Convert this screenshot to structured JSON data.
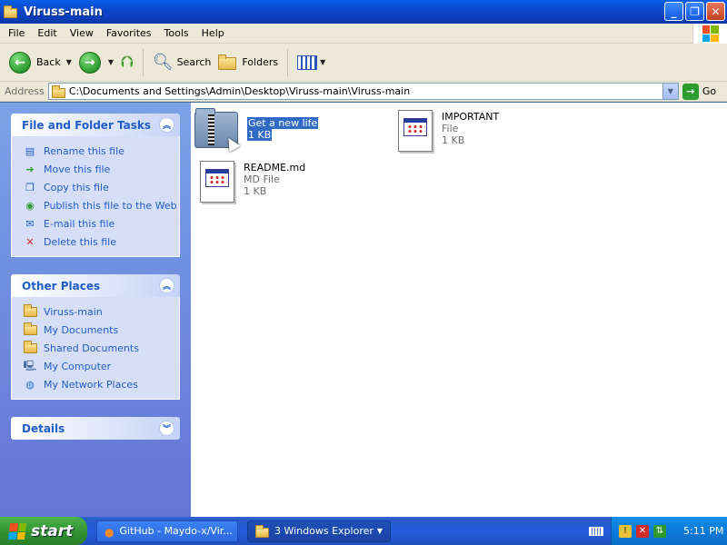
{
  "window": {
    "title": "Viruss-main"
  },
  "menu": [
    "File",
    "Edit",
    "View",
    "Favorites",
    "Tools",
    "Help"
  ],
  "toolbar": {
    "back_label": "Back",
    "search_label": "Search",
    "folders_label": "Folders"
  },
  "address": {
    "label": "Address",
    "value": "C:\\Documents and Settings\\Admin\\Desktop\\Viruss-main\\Viruss-main",
    "go_label": "Go"
  },
  "sidebar": {
    "tasks": {
      "title": "File and Folder Tasks",
      "items": [
        {
          "label": "Rename this file",
          "icon": "rename-icon"
        },
        {
          "label": "Move this file",
          "icon": "move-icon"
        },
        {
          "label": "Copy this file",
          "icon": "copy-icon"
        },
        {
          "label": "Publish this file to the Web",
          "icon": "publish-web-icon"
        },
        {
          "label": "E-mail this file",
          "icon": "email-icon"
        },
        {
          "label": "Delete this file",
          "icon": "delete-icon"
        }
      ]
    },
    "places": {
      "title": "Other Places",
      "items": [
        {
          "label": "Viruss-main",
          "icon": "folder-icon"
        },
        {
          "label": "My Documents",
          "icon": "my-documents-icon"
        },
        {
          "label": "Shared Documents",
          "icon": "shared-documents-icon"
        },
        {
          "label": "My Computer",
          "icon": "my-computer-icon"
        },
        {
          "label": "My Network Places",
          "icon": "network-places-icon"
        }
      ]
    },
    "details": {
      "title": "Details"
    }
  },
  "files": [
    {
      "name": "Get a new life",
      "type": "",
      "size": "1 KB",
      "icon": "zip-folder-icon",
      "selected": true
    },
    {
      "name": "IMPORTANT",
      "type": "File",
      "size": "1 KB",
      "icon": "document-icon",
      "selected": false
    },
    {
      "name": "README.md",
      "type": "MD File",
      "size": "1 KB",
      "icon": "document-icon",
      "selected": false
    }
  ],
  "taskbar": {
    "start_label": "start",
    "tasks": [
      {
        "label": "GitHub - Maydo-x/Vir...",
        "icon": "firefox-icon"
      },
      {
        "label": "3 Windows Explorer",
        "icon": "folder-icon"
      }
    ],
    "clock": "5:11 PM"
  },
  "colors": {
    "titlebar": "#0b46c8",
    "sidebar": "#7ba2e7",
    "link": "#215dc6",
    "selection": "#316ac5",
    "start": "#2f8f2f"
  }
}
